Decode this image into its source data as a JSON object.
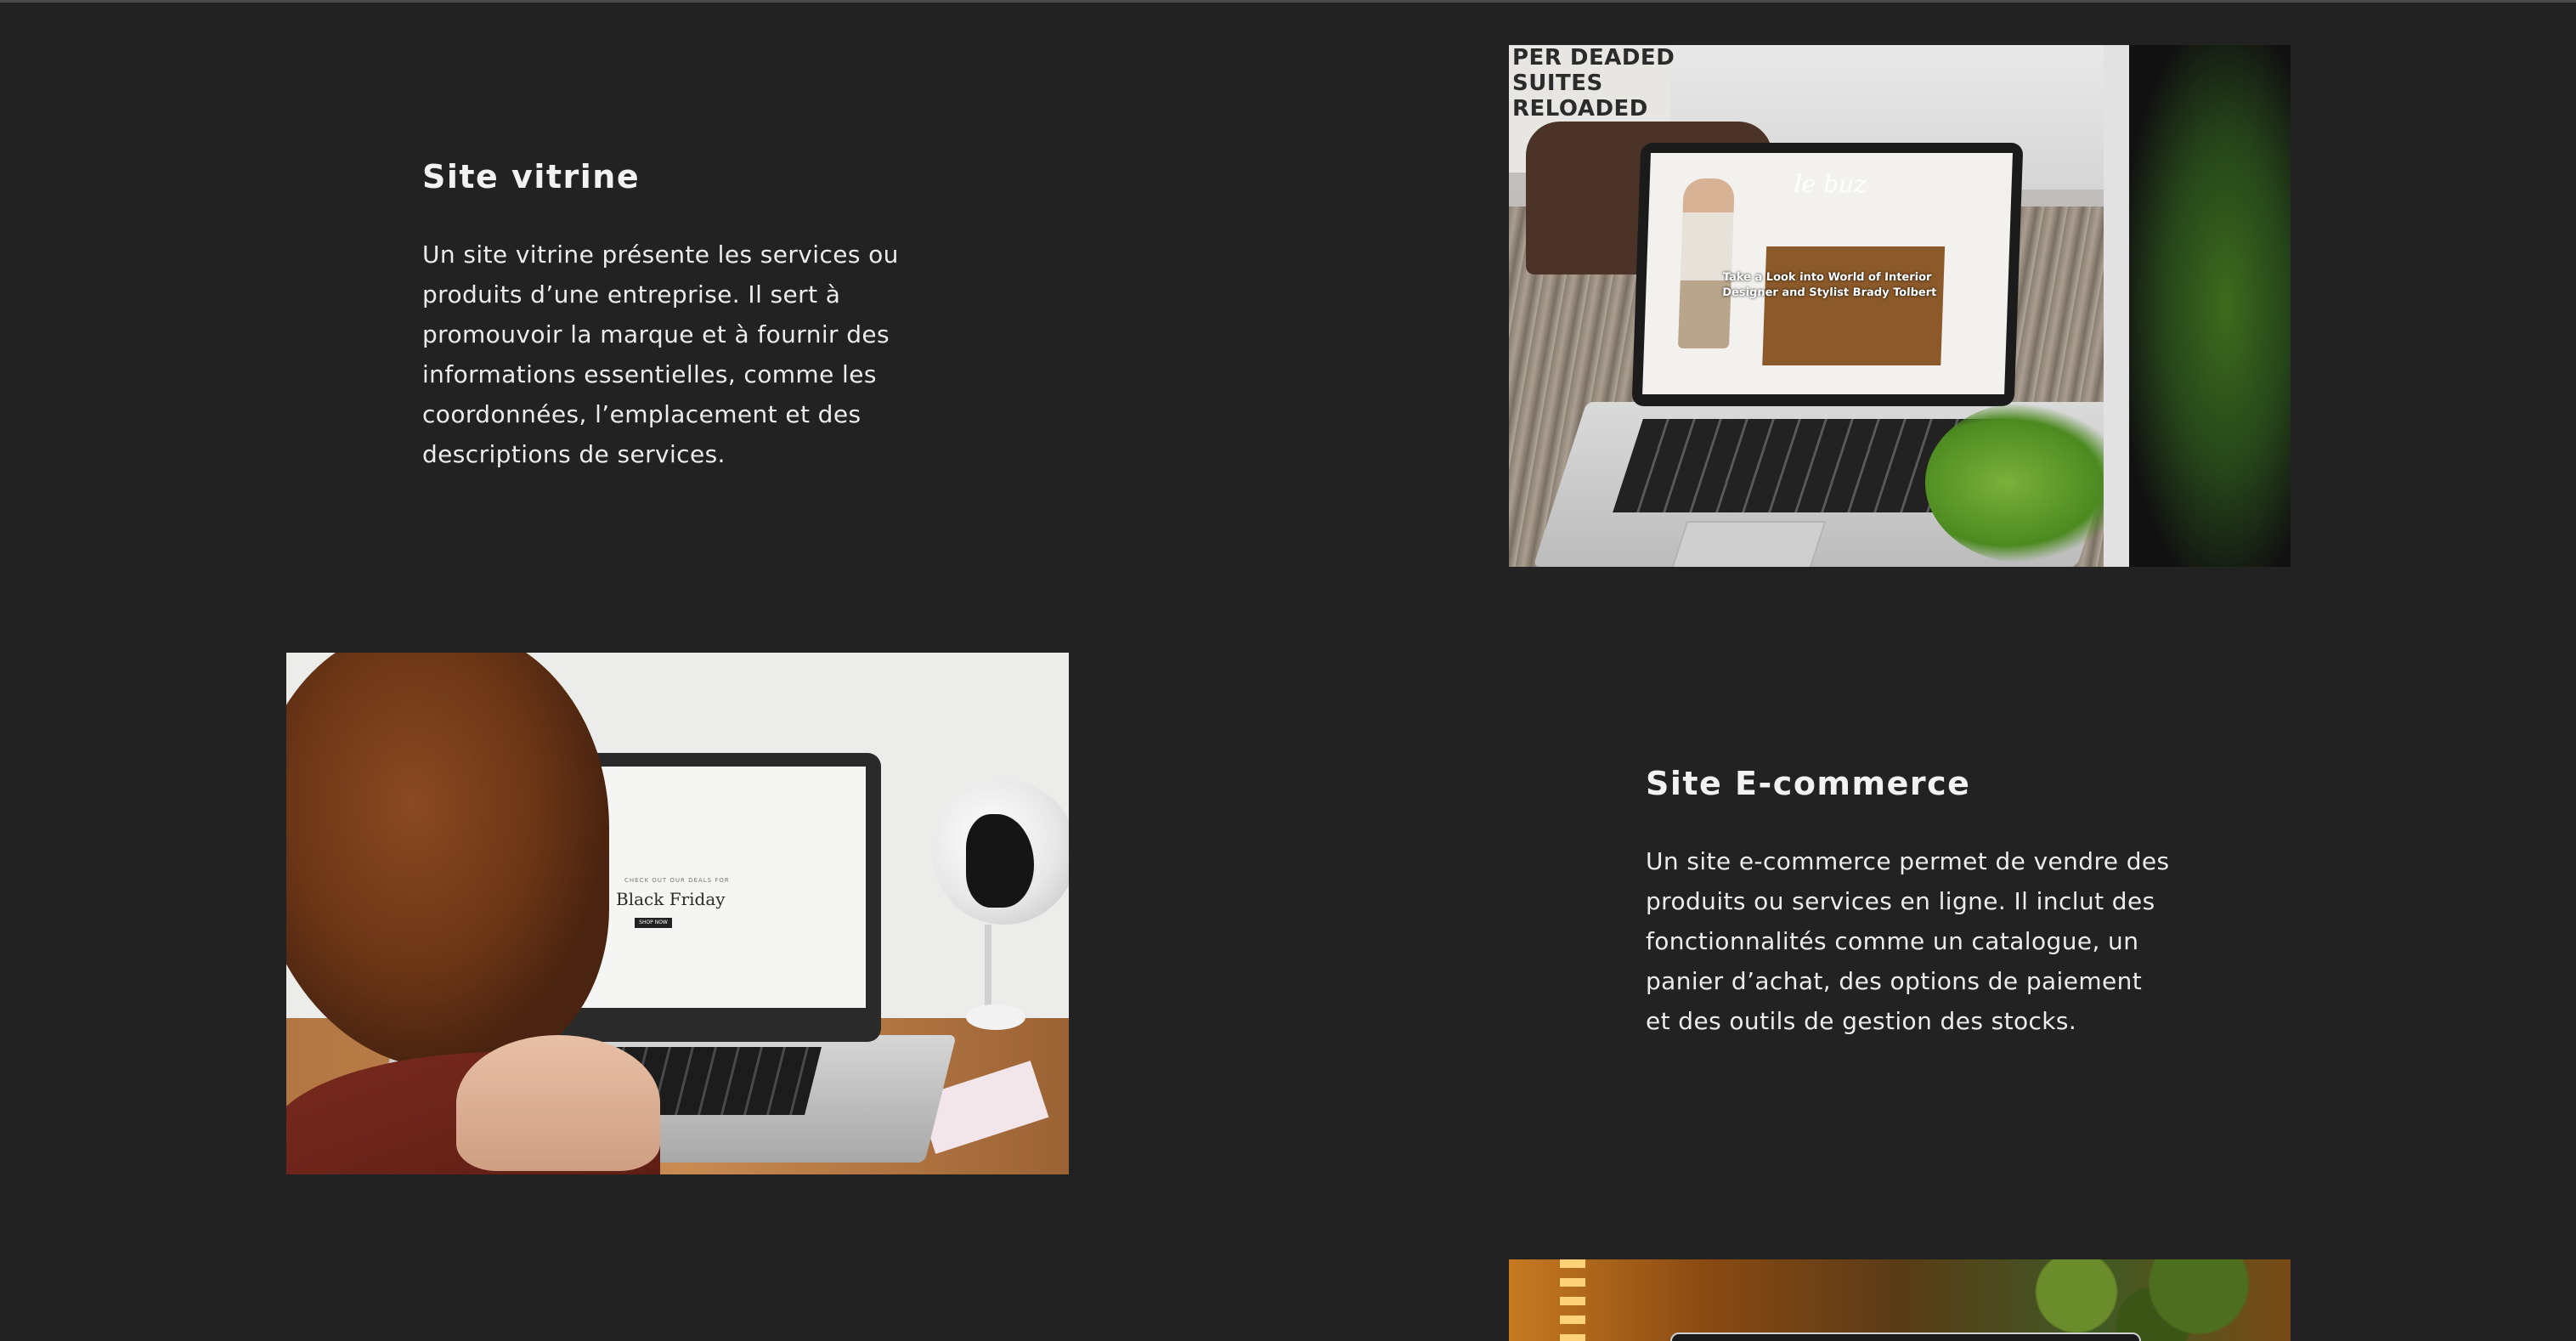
{
  "sections": [
    {
      "title": "Site vitrine",
      "description": "Un site vitrine présente les services ou produits d’une entreprise. Il sert à promouvoir la marque et à fournir des informations essentielles, comme les coordonnées, l’emplacement et des descriptions de services."
    },
    {
      "title": "Site E-commerce",
      "description": "Un site e-commerce permet de vendre des produits ou services en ligne. Il inclut des fonctionnalités comme un catalogue, un panier d’achat, des options de paiement et des outils de gestion des stocks."
    }
  ],
  "photos": {
    "vitrine": {
      "poster_text": "PER DEADED\nSUITES\nRELOADED",
      "screen_logo": "le buz",
      "screen_headline": "Take a Look into World of Interior Designer and Stylist Brady Tolbert"
    },
    "ecommerce": {
      "screen_kicker": "CHECK OUT OUR DEALS FOR",
      "screen_title": "Black Friday",
      "screen_button": "SHOP NOW"
    }
  },
  "colors": {
    "background": "#222222",
    "text": "#f0f0f0"
  }
}
